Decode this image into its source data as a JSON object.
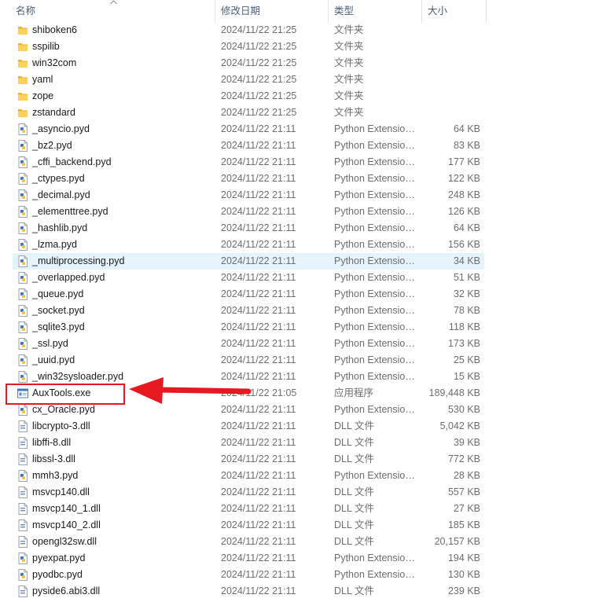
{
  "header": {
    "name_label": "名称",
    "date_label": "修改日期",
    "type_label": "类型",
    "size_label": "大小"
  },
  "files": [
    {
      "name": "shiboken6",
      "date": "2024/11/22 21:25",
      "type": "文件夹",
      "size": "",
      "icon": "folder-icon"
    },
    {
      "name": "sspilib",
      "date": "2024/11/22 21:25",
      "type": "文件夹",
      "size": "",
      "icon": "folder-icon"
    },
    {
      "name": "win32com",
      "date": "2024/11/22 21:25",
      "type": "文件夹",
      "size": "",
      "icon": "folder-icon"
    },
    {
      "name": "yaml",
      "date": "2024/11/22 21:25",
      "type": "文件夹",
      "size": "",
      "icon": "folder-icon"
    },
    {
      "name": "zope",
      "date": "2024/11/22 21:25",
      "type": "文件夹",
      "size": "",
      "icon": "folder-icon"
    },
    {
      "name": "zstandard",
      "date": "2024/11/22 21:25",
      "type": "文件夹",
      "size": "",
      "icon": "folder-icon"
    },
    {
      "name": "_asyncio.pyd",
      "date": "2024/11/22 21:11",
      "type": "Python Extension Module",
      "size": "64 KB",
      "icon": "python-file-icon"
    },
    {
      "name": "_bz2.pyd",
      "date": "2024/11/22 21:11",
      "type": "Python Extension Module",
      "size": "83 KB",
      "icon": "python-file-icon"
    },
    {
      "name": "_cffi_backend.pyd",
      "date": "2024/11/22 21:11",
      "type": "Python Extension Module",
      "size": "177 KB",
      "icon": "python-file-icon"
    },
    {
      "name": "_ctypes.pyd",
      "date": "2024/11/22 21:11",
      "type": "Python Extension Module",
      "size": "122 KB",
      "icon": "python-file-icon"
    },
    {
      "name": "_decimal.pyd",
      "date": "2024/11/22 21:11",
      "type": "Python Extension Module",
      "size": "248 KB",
      "icon": "python-file-icon"
    },
    {
      "name": "_elementtree.pyd",
      "date": "2024/11/22 21:11",
      "type": "Python Extension Module",
      "size": "126 KB",
      "icon": "python-file-icon"
    },
    {
      "name": "_hashlib.pyd",
      "date": "2024/11/22 21:11",
      "type": "Python Extension Module",
      "size": "64 KB",
      "icon": "python-file-icon"
    },
    {
      "name": "_lzma.pyd",
      "date": "2024/11/22 21:11",
      "type": "Python Extension Module",
      "size": "156 KB",
      "icon": "python-file-icon"
    },
    {
      "name": "_multiprocessing.pyd",
      "date": "2024/11/22 21:11",
      "type": "Python Extension Module",
      "size": "34 KB",
      "icon": "python-file-icon",
      "hover": true
    },
    {
      "name": "_overlapped.pyd",
      "date": "2024/11/22 21:11",
      "type": "Python Extension Module",
      "size": "51 KB",
      "icon": "python-file-icon"
    },
    {
      "name": "_queue.pyd",
      "date": "2024/11/22 21:11",
      "type": "Python Extension Module",
      "size": "32 KB",
      "icon": "python-file-icon"
    },
    {
      "name": "_socket.pyd",
      "date": "2024/11/22 21:11",
      "type": "Python Extension Module",
      "size": "78 KB",
      "icon": "python-file-icon"
    },
    {
      "name": "_sqlite3.pyd",
      "date": "2024/11/22 21:11",
      "type": "Python Extension Module",
      "size": "118 KB",
      "icon": "python-file-icon"
    },
    {
      "name": "_ssl.pyd",
      "date": "2024/11/22 21:11",
      "type": "Python Extension Module",
      "size": "173 KB",
      "icon": "python-file-icon"
    },
    {
      "name": "_uuid.pyd",
      "date": "2024/11/22 21:11",
      "type": "Python Extension Module",
      "size": "25 KB",
      "icon": "python-file-icon"
    },
    {
      "name": "_win32sysloader.pyd",
      "date": "2024/11/22 21:11",
      "type": "Python Extension Module",
      "size": "15 KB",
      "icon": "python-file-icon"
    },
    {
      "name": "AuxTools.exe",
      "date": "2024/11/22 21:05",
      "type": "应用程序",
      "size": "189,448 KB",
      "icon": "exe-app-icon",
      "annotated": true
    },
    {
      "name": "cx_Oracle.pyd",
      "date": "2024/11/22 21:11",
      "type": "Python Extension Module",
      "size": "530 KB",
      "icon": "python-file-icon"
    },
    {
      "name": "libcrypto-3.dll",
      "date": "2024/11/22 21:11",
      "type": "DLL 文件",
      "size": "5,042 KB",
      "icon": "dll-file-icon"
    },
    {
      "name": "libffi-8.dll",
      "date": "2024/11/22 21:11",
      "type": "DLL 文件",
      "size": "39 KB",
      "icon": "dll-file-icon"
    },
    {
      "name": "libssl-3.dll",
      "date": "2024/11/22 21:11",
      "type": "DLL 文件",
      "size": "772 KB",
      "icon": "dll-file-icon"
    },
    {
      "name": "mmh3.pyd",
      "date": "2024/11/22 21:11",
      "type": "Python Extension Module",
      "size": "28 KB",
      "icon": "python-file-icon"
    },
    {
      "name": "msvcp140.dll",
      "date": "2024/11/22 21:11",
      "type": "DLL 文件",
      "size": "557 KB",
      "icon": "dll-file-icon"
    },
    {
      "name": "msvcp140_1.dll",
      "date": "2024/11/22 21:11",
      "type": "DLL 文件",
      "size": "27 KB",
      "icon": "dll-file-icon"
    },
    {
      "name": "msvcp140_2.dll",
      "date": "2024/11/22 21:11",
      "type": "DLL 文件",
      "size": "185 KB",
      "icon": "dll-file-icon"
    },
    {
      "name": "opengl32sw.dll",
      "date": "2024/11/22 21:11",
      "type": "DLL 文件",
      "size": "20,157 KB",
      "icon": "dll-file-icon"
    },
    {
      "name": "pyexpat.pyd",
      "date": "2024/11/22 21:11",
      "type": "Python Extension Module",
      "size": "194 KB",
      "icon": "python-file-icon"
    },
    {
      "name": "pyodbc.pyd",
      "date": "2024/11/22 21:11",
      "type": "Python Extension Module",
      "size": "130 KB",
      "icon": "python-file-icon"
    },
    {
      "name": "pyside6.abi3.dll",
      "date": "2024/11/22 21:11",
      "type": "DLL 文件",
      "size": "239 KB",
      "icon": "dll-file-icon"
    }
  ],
  "colors": {
    "annotation_red": "#e5191f",
    "hover_bg": "#e5f3fb",
    "folder_yellow": "#f8c43c"
  }
}
